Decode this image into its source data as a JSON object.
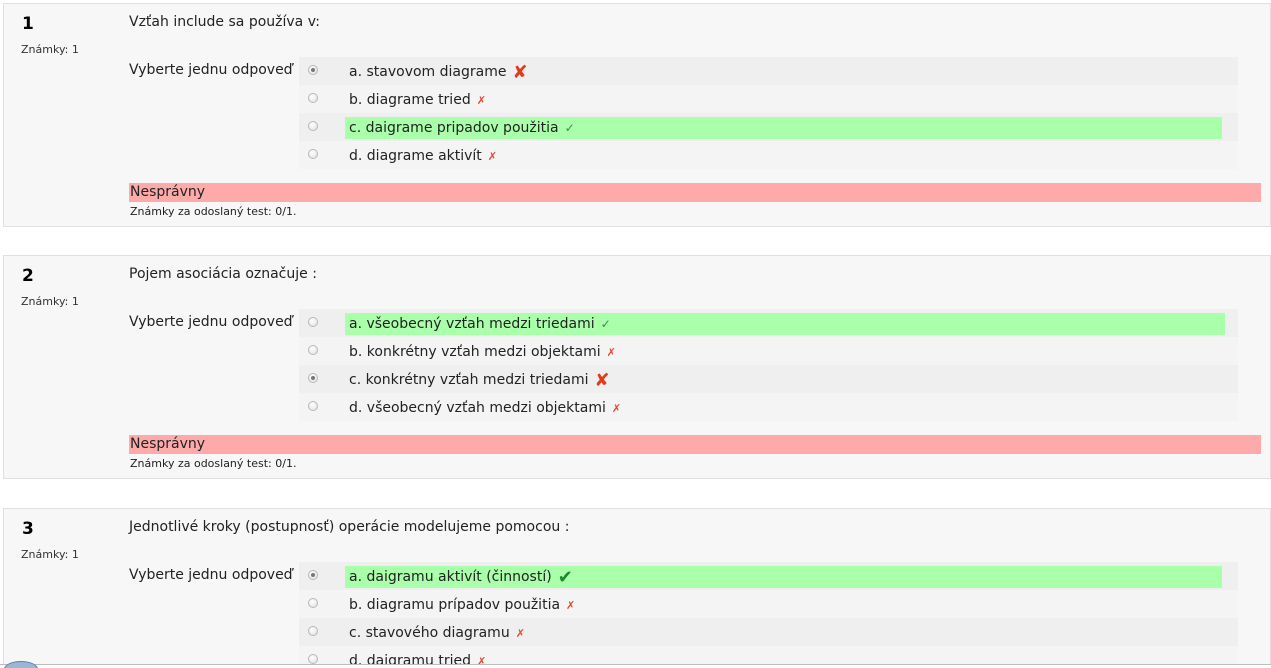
{
  "prompt_label": "Vyberte jednu odpoveď",
  "questions": [
    {
      "number": "1",
      "grade": "Známky: 1",
      "text": "Vzťah include sa používa v:",
      "feedback": "Nesprávny",
      "grade_summary": "Známky za odoslaný test: 0/1.",
      "answers": [
        {
          "label": "a. stavovom diagrame",
          "selected": true,
          "correct": false,
          "mark": "cross-big-icon"
        },
        {
          "label": "b. diagrame tried",
          "selected": false,
          "correct": false,
          "mark": "cross-small-icon"
        },
        {
          "label": "c. daigrame pripadov použitia",
          "selected": false,
          "correct": true,
          "mark": "check-small-icon"
        },
        {
          "label": "d. diagrame aktivít",
          "selected": false,
          "correct": false,
          "mark": "cross-small-icon"
        }
      ]
    },
    {
      "number": "2",
      "grade": "Známky: 1",
      "text": "Pojem asociácia označuje :",
      "feedback": "Nesprávny",
      "grade_summary": "Známky za odoslaný test: 0/1.",
      "answers": [
        {
          "label": "a. všeobecný vzťah medzi triedami",
          "selected": false,
          "correct": true,
          "mark": "check-small-icon"
        },
        {
          "label": "b. konkrétny vzťah medzi objektami",
          "selected": false,
          "correct": false,
          "mark": "cross-small-icon"
        },
        {
          "label": "c. konkrétny vzťah medzi triedami",
          "selected": true,
          "correct": false,
          "mark": "cross-big-icon"
        },
        {
          "label": "d. všeobecný vzťah medzi objektami",
          "selected": false,
          "correct": false,
          "mark": "cross-small-icon"
        }
      ]
    },
    {
      "number": "3",
      "grade": "Známky: 1",
      "text": "Jednotlivé kroky (postupnosť) operácie modelujeme pomocou :",
      "answers": [
        {
          "label": "a. daigramu aktivít (činností)",
          "selected": true,
          "correct": true,
          "mark": "check-big-icon"
        },
        {
          "label": "b. diagramu prípadov použitia",
          "selected": false,
          "correct": false,
          "mark": "cross-small-icon"
        },
        {
          "label": "c. stavového diagramu",
          "selected": false,
          "correct": false,
          "mark": "cross-small-icon"
        },
        {
          "label": "d. daigramu tried",
          "selected": false,
          "correct": false,
          "mark": "cross-small-icon"
        }
      ]
    }
  ],
  "colors": {
    "correct_bg": "#aaffaa",
    "incorrect_feedback_bg": "#ffaaaa",
    "cross": "#e43a1c",
    "check": "#1c8a2a"
  }
}
